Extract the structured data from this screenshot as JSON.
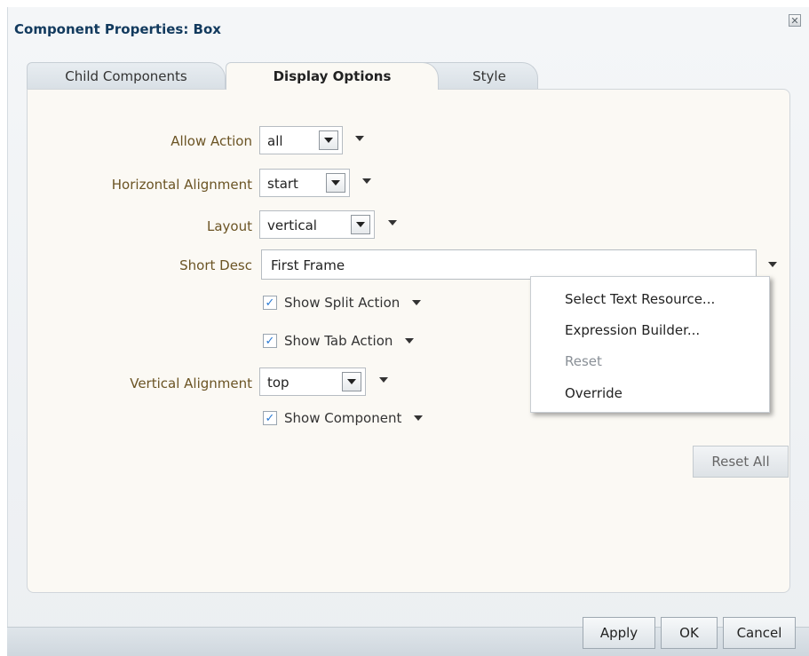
{
  "dialog": {
    "title": "Component Properties: Box",
    "close_icon": "close-icon"
  },
  "tabs": [
    {
      "label": "Child Components",
      "active": false
    },
    {
      "label": "Display Options",
      "active": true
    },
    {
      "label": "Style",
      "active": false
    }
  ],
  "fields": {
    "allow_action": {
      "label": "Allow Action",
      "value": "all"
    },
    "horizontal_alignment": {
      "label": "Horizontal Alignment",
      "value": "start"
    },
    "layout": {
      "label": "Layout",
      "value": "vertical"
    },
    "short_desc": {
      "label": "Short Desc",
      "value": "First Frame"
    },
    "show_split_action": {
      "label": "Show Split Action",
      "checked": true
    },
    "show_tab_action": {
      "label": "Show Tab Action",
      "checked": true
    },
    "vertical_alignment": {
      "label": "Vertical Alignment",
      "value": "top"
    },
    "show_component": {
      "label": "Show Component",
      "checked": true
    }
  },
  "context_menu": {
    "items": [
      {
        "label": "Select Text Resource...",
        "enabled": true
      },
      {
        "label": "Expression Builder...",
        "enabled": true
      },
      {
        "label": "Reset",
        "enabled": false
      },
      {
        "label": "Override",
        "enabled": true
      }
    ]
  },
  "buttons": {
    "reset_all": "Reset All",
    "apply": "Apply",
    "ok": "OK",
    "cancel": "Cancel"
  },
  "colors": {
    "title": "#123a5e",
    "label": "#6b5424",
    "panel_bg": "#fbf9f4",
    "check_accent": "#2b7ad3"
  }
}
